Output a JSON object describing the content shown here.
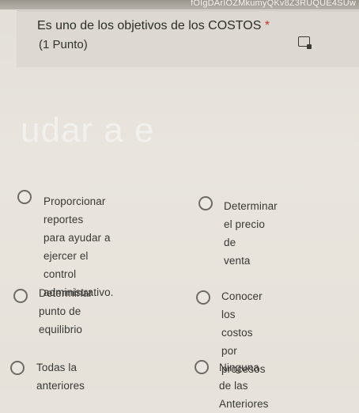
{
  "browser": {
    "url_fragment": "fOIgDArIOZMkumyQKv8Z3RUQUE4SUw"
  },
  "question": {
    "title": "Es uno de los objetivos de los COSTOS",
    "required_marker": "*",
    "points": "(1 Punto)",
    "icon": "immersive-reader-icon"
  },
  "background_watermark": "udar a e",
  "options": [
    {
      "label": "Proporcionar reportes\npara ayudar a ejercer el\ncontrol administrativo.",
      "selected": false
    },
    {
      "label": "Determinar el precio de\nventa",
      "selected": false
    },
    {
      "label": "Determinar punto de\nequilibrio",
      "selected": false
    },
    {
      "label": "Conocer los costos por\nprocesos",
      "selected": false
    },
    {
      "label": "Todas la anteriores",
      "selected": false
    },
    {
      "label": "Ninguna de las\nAnteriores",
      "selected": false
    }
  ],
  "colors": {
    "page_bg": "#e7e3dc",
    "question_bg": "#ddd9d2",
    "required": "#c23a2f",
    "radio_border": "#6f6b64"
  }
}
